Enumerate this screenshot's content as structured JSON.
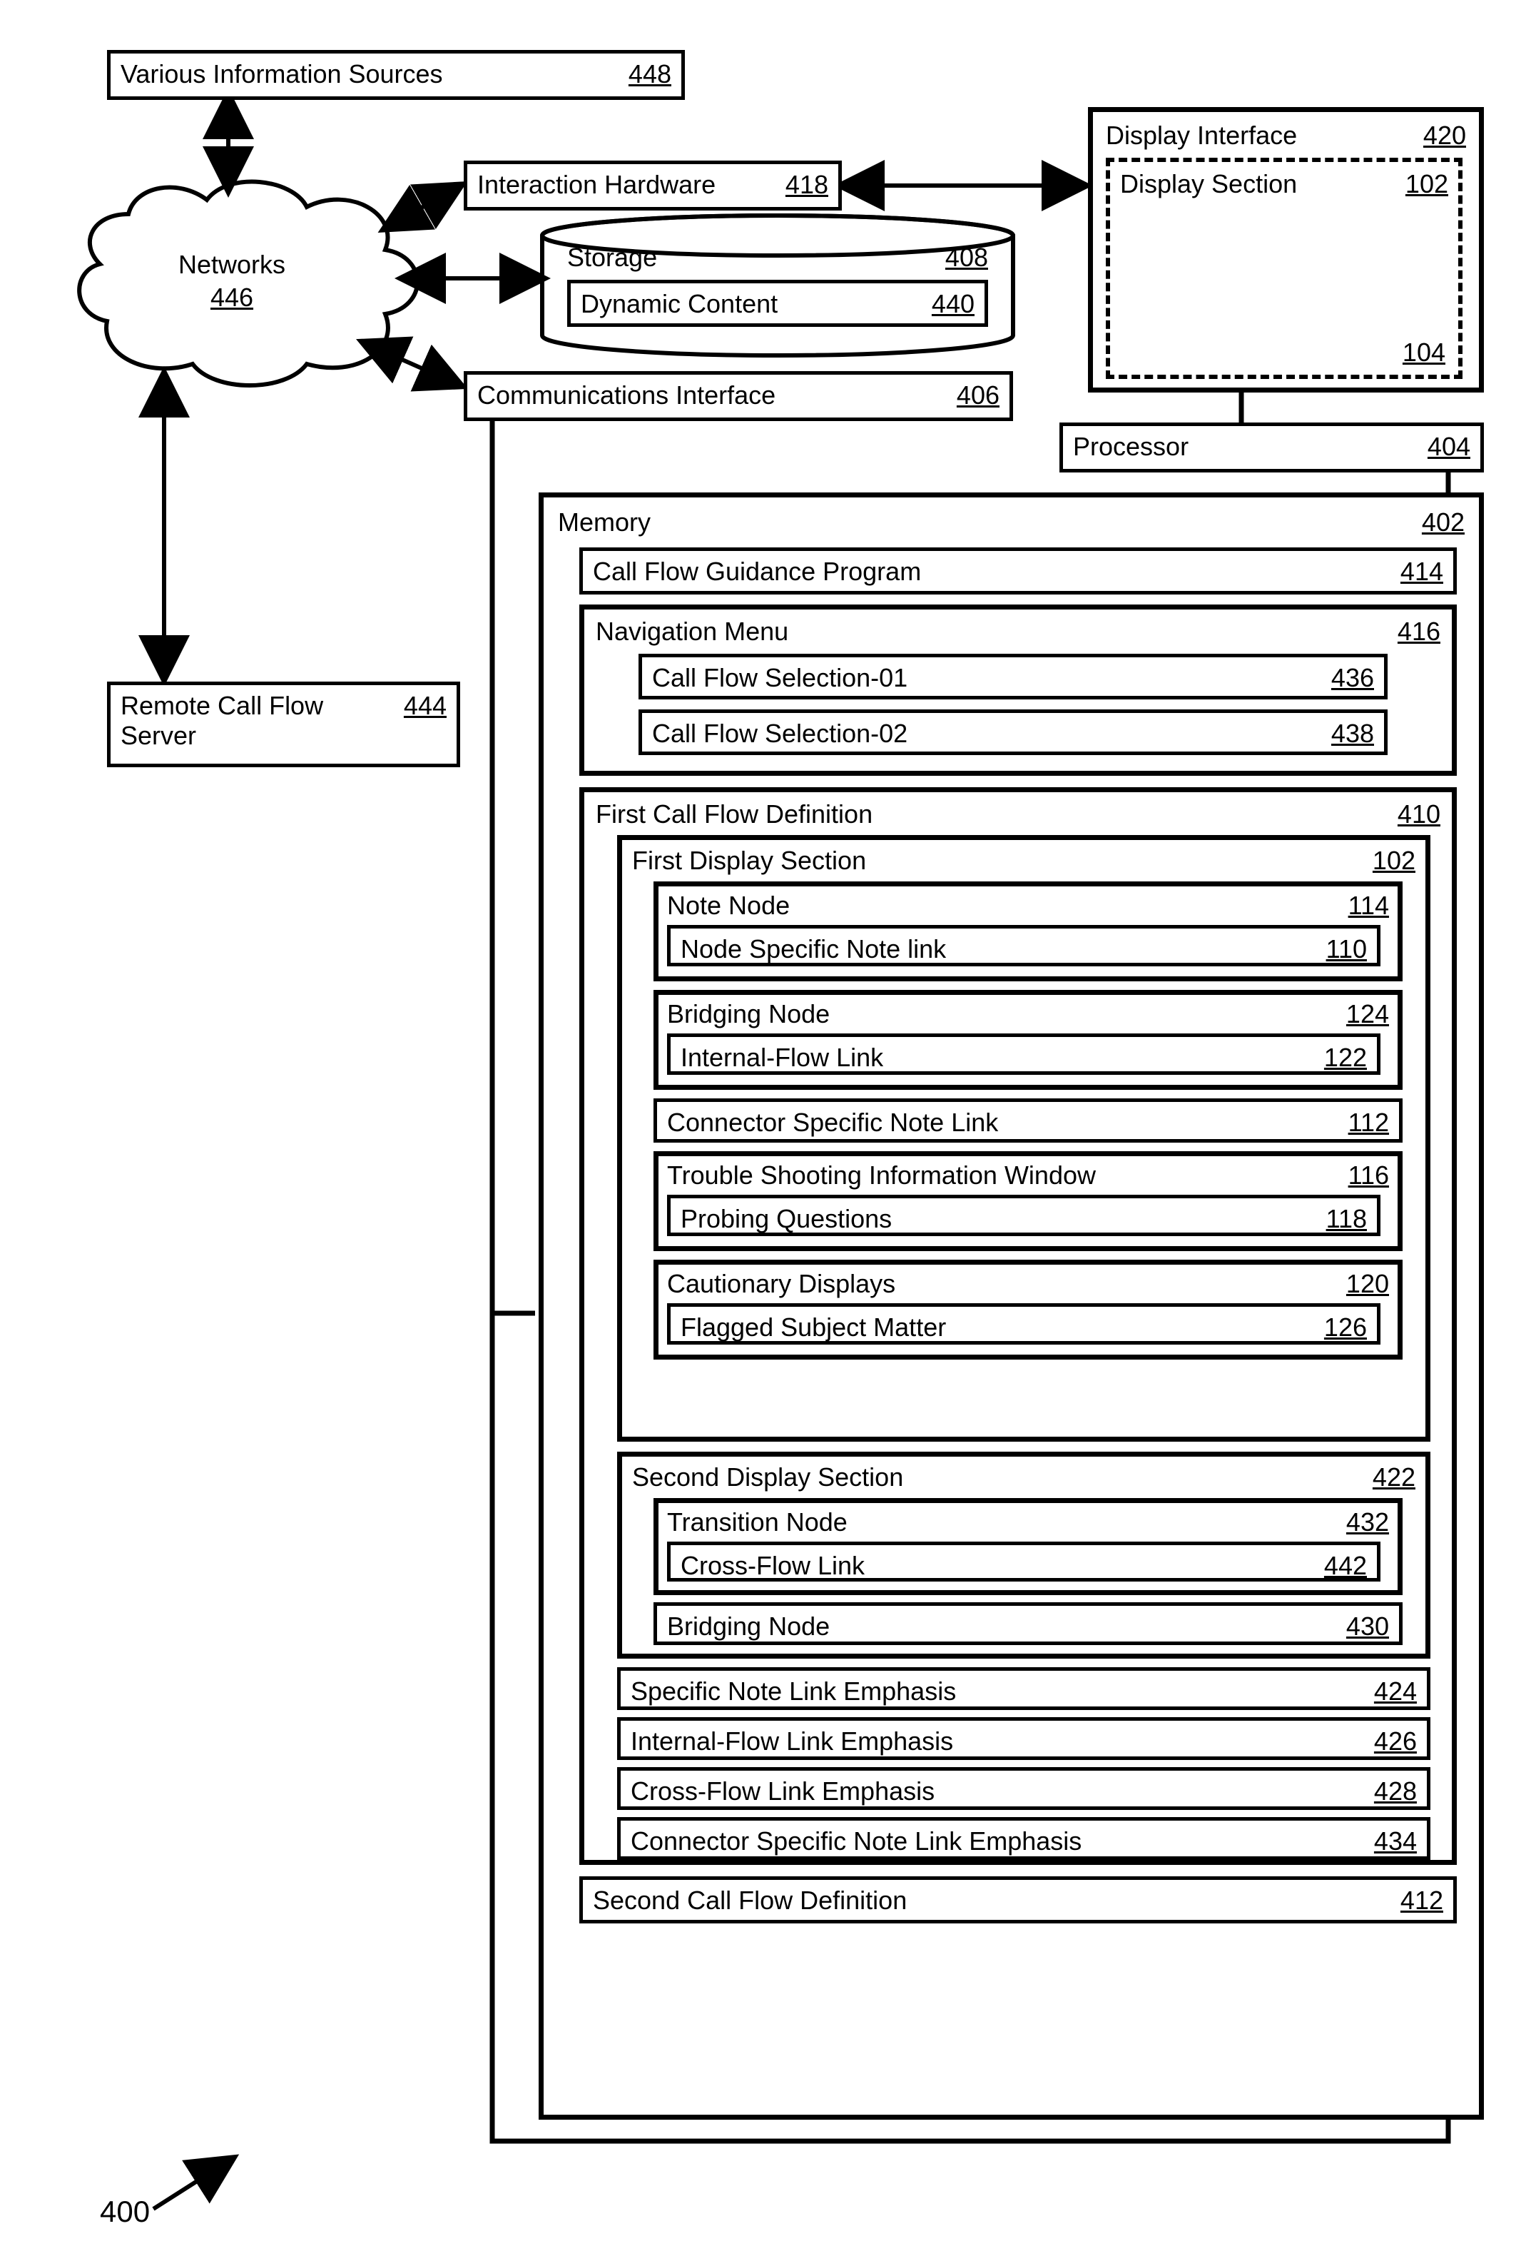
{
  "fig_number": "400",
  "info_sources": {
    "label": "Various Information Sources",
    "ref": "448"
  },
  "networks": {
    "label": "Networks",
    "ref": "446"
  },
  "interaction_hw": {
    "label": "Interaction Hardware",
    "ref": "418"
  },
  "storage": {
    "label": "Storage",
    "ref": "408"
  },
  "dynamic_content": {
    "label": "Dynamic Content",
    "ref": "440"
  },
  "comm_iface": {
    "label": "Communications Interface",
    "ref": "406"
  },
  "display_iface": {
    "label": "Display Interface",
    "ref": "420"
  },
  "display_section_top": {
    "label": "Display Section",
    "ref": "102"
  },
  "display_section_ptr": "104",
  "processor": {
    "label": "Processor",
    "ref": "404"
  },
  "remote_server": {
    "label": "Remote Call Flow Server",
    "ref": "444"
  },
  "memory": {
    "label": "Memory",
    "ref": "402"
  },
  "cfgp": {
    "label": "Call Flow Guidance Program",
    "ref": "414"
  },
  "nav_menu": {
    "label": "Navigation Menu",
    "ref": "416"
  },
  "cfs1": {
    "label": "Call Flow Selection-01",
    "ref": "436"
  },
  "cfs2": {
    "label": "Call Flow Selection-02",
    "ref": "438"
  },
  "first_cfd": {
    "label": "First Call Flow Definition",
    "ref": "410"
  },
  "first_ds": {
    "label": "First Display Section",
    "ref": "102"
  },
  "note_node": {
    "label": "Note Node",
    "ref": "114"
  },
  "node_link": {
    "label": "Node Specific Note link",
    "ref": "110"
  },
  "bridging": {
    "label": "Bridging Node",
    "ref": "124"
  },
  "internal_link": {
    "label": "Internal-Flow Link",
    "ref": "122"
  },
  "conn_link": {
    "label": "Connector Specific Note Link",
    "ref": "112"
  },
  "tsw": {
    "label": "Trouble Shooting Information Window",
    "ref": "116"
  },
  "probing": {
    "label": "Probing Questions",
    "ref": "118"
  },
  "caution": {
    "label": "Cautionary Displays",
    "ref": "120"
  },
  "flagged": {
    "label": "Flagged Subject Matter",
    "ref": "126"
  },
  "second_ds": {
    "label": "Second Display Section",
    "ref": "422"
  },
  "trans_node": {
    "label": "Transition Node",
    "ref": "432"
  },
  "crossflow": {
    "label": "Cross-Flow Link",
    "ref": "442"
  },
  "bridging2": {
    "label": "Bridging Node",
    "ref": "430"
  },
  "emph_specific": {
    "label": "Specific Note Link Emphasis",
    "ref": "424"
  },
  "emph_internal": {
    "label": "Internal-Flow Link Emphasis",
    "ref": "426"
  },
  "emph_cross": {
    "label": "Cross-Flow Link Emphasis",
    "ref": "428"
  },
  "emph_conn": {
    "label": "Connector Specific Note Link Emphasis",
    "ref": "434"
  },
  "second_cfd": {
    "label": "Second Call Flow Definition",
    "ref": "412"
  }
}
